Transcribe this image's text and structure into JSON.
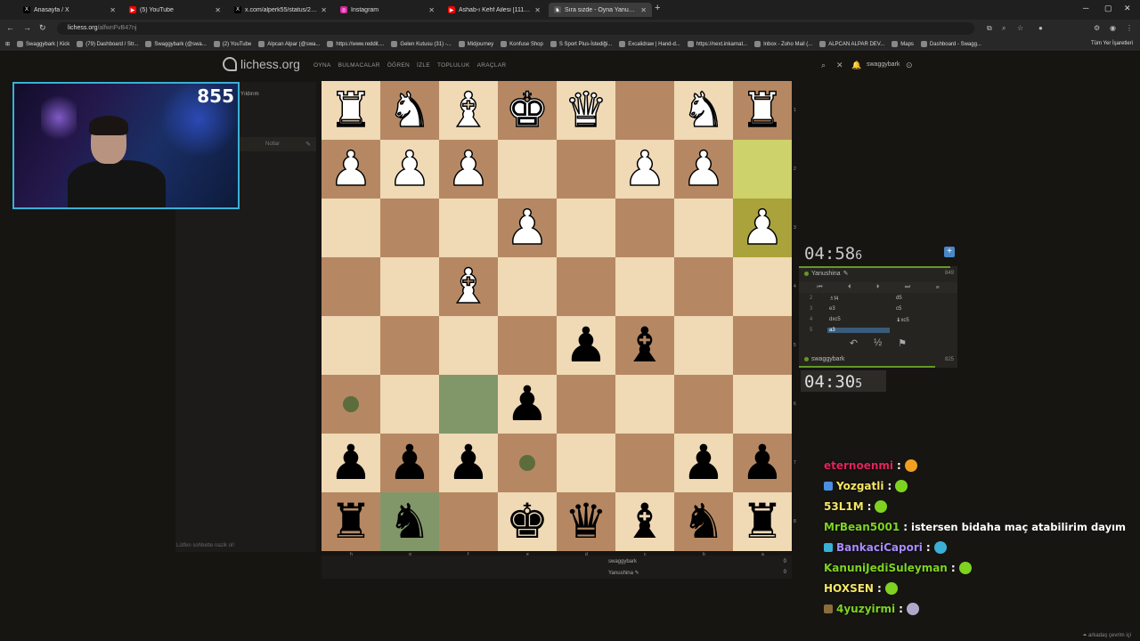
{
  "browser": {
    "tabs": [
      {
        "title": "Anasayfa / X",
        "fav": "X",
        "color": "#000000",
        "active": false
      },
      {
        "title": "(5) YouTube",
        "fav": "▶",
        "color": "#ff0000",
        "active": false
      },
      {
        "title": "x.com/alperk55/status/200989",
        "fav": "X",
        "color": "#000000",
        "active": false
      },
      {
        "title": "Instagram",
        "fav": "◎",
        "color": "#d6249f",
        "active": false
      },
      {
        "title": "Ashab-ı Kehf Ailesi [111] - bayi",
        "fav": "▶",
        "color": "#ff0000",
        "active": false
      },
      {
        "title": "Sıra sizde - Oyna Yanushina • li",
        "fav": "♞",
        "color": "#555555",
        "active": true
      }
    ],
    "url_host": "lichess.org",
    "url_path": "/alfwnFvB47nj",
    "bookmarks": [
      "Swaggybark | Kick",
      "(79) Dashboard / Str...",
      "Swaggybark (@swa...",
      "(2) YouTube",
      "Alpcan Alpar (@swa...",
      "https://www.reddit....",
      "Gelen Kutusu (31) -...",
      "Midjourney",
      "Konfuse Shop",
      "S Sport Plus-İstediği...",
      "Excalidraw | Hand-d...",
      "https://next.inkarnat...",
      "Inbox - Zoho Mail (...",
      "ALPCAN ALPAR DEV...",
      "Maps",
      "Dashboard - Swagg..."
    ],
    "bookmarks_all": "Tüm Yer İşaretleri"
  },
  "lichess": {
    "logo": "lichess.org",
    "nav": [
      "OYNA",
      "BULMACALAR",
      "ÖĞREN",
      "İZLE",
      "TOPLULUK",
      "ARAÇLAR"
    ],
    "user": "swaggybark"
  },
  "stream": {
    "viewer_count": "855"
  },
  "left_panel": {
    "title": "Yıldırım",
    "notes": "Notlar",
    "chat_placeholder": "Lütfen sohbette nazik ol!"
  },
  "board": {
    "ranks": [
      "1",
      "2",
      "3",
      "4",
      "5",
      "6",
      "7",
      "8"
    ],
    "files": [
      "h",
      "g",
      "f",
      "e",
      "d",
      "c",
      "b",
      "a"
    ]
  },
  "game": {
    "opponent": {
      "name": "Yanushina",
      "rating": "849",
      "clock_main": "04:58",
      "clock_tenth": "6"
    },
    "me": {
      "name": "swaggybark",
      "rating": "825",
      "clock_main": "04:30",
      "clock_tenth": "5"
    },
    "moves": [
      {
        "n": "2",
        "w": "♗f4",
        "b": "d5"
      },
      {
        "n": "3",
        "w": "e3",
        "b": "c5"
      },
      {
        "n": "4",
        "w": "dxc5",
        "b": "♝xc5"
      },
      {
        "n": "5",
        "w": "a3",
        "b": ""
      }
    ],
    "actions": {
      "takeback": "↶",
      "draw": "½",
      "resign": "⚑"
    },
    "crosstable": [
      {
        "name": "swaggybark",
        "score": "0"
      },
      {
        "name": "Yanushina ✎",
        "score": "0"
      }
    ]
  },
  "chat": [
    {
      "user": "eternoenmi",
      "color": "#e0245e",
      "text": "",
      "emote": "#f0a020",
      "badge": ""
    },
    {
      "user": "Yozgatli",
      "color": "#f5e663",
      "text": "",
      "emote": "#7ed321",
      "badge": "#4a90e2"
    },
    {
      "user": "53L1M",
      "color": "#f5e663",
      "text": "",
      "emote": "#7ed321",
      "badge": ""
    },
    {
      "user": "MrBean5001",
      "color": "#7ed321",
      "text": "istersen bidaha maç atabilirim dayım",
      "emote": "",
      "badge": ""
    },
    {
      "user": "BankaciCapori",
      "color": "#a98bff",
      "text": "",
      "emote": "#3ab0d6",
      "badge": "#3ab0d6"
    },
    {
      "user": "KanuniJediSuleyman",
      "color": "#7ed321",
      "text": "",
      "emote": "#7ed321",
      "badge": ""
    },
    {
      "user": "HOXSEN",
      "color": "#f5e663",
      "text": "",
      "emote": "#7ed321",
      "badge": ""
    },
    {
      "user": "4yuzyirmi",
      "color": "#7ed321",
      "text": "",
      "emote": "#b0a8c8",
      "badge": "#8a6d3b"
    }
  ],
  "friends_online": "⏶ arkadaş çevrim içi"
}
